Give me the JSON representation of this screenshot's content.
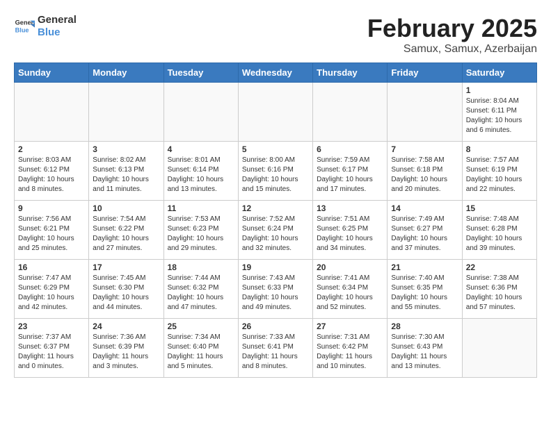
{
  "logo": {
    "line1": "General",
    "line2": "Blue"
  },
  "title": "February 2025",
  "subtitle": "Samux, Samux, Azerbaijan",
  "weekdays": [
    "Sunday",
    "Monday",
    "Tuesday",
    "Wednesday",
    "Thursday",
    "Friday",
    "Saturday"
  ],
  "weeks": [
    [
      {
        "day": "",
        "info": ""
      },
      {
        "day": "",
        "info": ""
      },
      {
        "day": "",
        "info": ""
      },
      {
        "day": "",
        "info": ""
      },
      {
        "day": "",
        "info": ""
      },
      {
        "day": "",
        "info": ""
      },
      {
        "day": "1",
        "info": "Sunrise: 8:04 AM\nSunset: 6:11 PM\nDaylight: 10 hours\nand 6 minutes."
      }
    ],
    [
      {
        "day": "2",
        "info": "Sunrise: 8:03 AM\nSunset: 6:12 PM\nDaylight: 10 hours\nand 8 minutes."
      },
      {
        "day": "3",
        "info": "Sunrise: 8:02 AM\nSunset: 6:13 PM\nDaylight: 10 hours\nand 11 minutes."
      },
      {
        "day": "4",
        "info": "Sunrise: 8:01 AM\nSunset: 6:14 PM\nDaylight: 10 hours\nand 13 minutes."
      },
      {
        "day": "5",
        "info": "Sunrise: 8:00 AM\nSunset: 6:16 PM\nDaylight: 10 hours\nand 15 minutes."
      },
      {
        "day": "6",
        "info": "Sunrise: 7:59 AM\nSunset: 6:17 PM\nDaylight: 10 hours\nand 17 minutes."
      },
      {
        "day": "7",
        "info": "Sunrise: 7:58 AM\nSunset: 6:18 PM\nDaylight: 10 hours\nand 20 minutes."
      },
      {
        "day": "8",
        "info": "Sunrise: 7:57 AM\nSunset: 6:19 PM\nDaylight: 10 hours\nand 22 minutes."
      }
    ],
    [
      {
        "day": "9",
        "info": "Sunrise: 7:56 AM\nSunset: 6:21 PM\nDaylight: 10 hours\nand 25 minutes."
      },
      {
        "day": "10",
        "info": "Sunrise: 7:54 AM\nSunset: 6:22 PM\nDaylight: 10 hours\nand 27 minutes."
      },
      {
        "day": "11",
        "info": "Sunrise: 7:53 AM\nSunset: 6:23 PM\nDaylight: 10 hours\nand 29 minutes."
      },
      {
        "day": "12",
        "info": "Sunrise: 7:52 AM\nSunset: 6:24 PM\nDaylight: 10 hours\nand 32 minutes."
      },
      {
        "day": "13",
        "info": "Sunrise: 7:51 AM\nSunset: 6:25 PM\nDaylight: 10 hours\nand 34 minutes."
      },
      {
        "day": "14",
        "info": "Sunrise: 7:49 AM\nSunset: 6:27 PM\nDaylight: 10 hours\nand 37 minutes."
      },
      {
        "day": "15",
        "info": "Sunrise: 7:48 AM\nSunset: 6:28 PM\nDaylight: 10 hours\nand 39 minutes."
      }
    ],
    [
      {
        "day": "16",
        "info": "Sunrise: 7:47 AM\nSunset: 6:29 PM\nDaylight: 10 hours\nand 42 minutes."
      },
      {
        "day": "17",
        "info": "Sunrise: 7:45 AM\nSunset: 6:30 PM\nDaylight: 10 hours\nand 44 minutes."
      },
      {
        "day": "18",
        "info": "Sunrise: 7:44 AM\nSunset: 6:32 PM\nDaylight: 10 hours\nand 47 minutes."
      },
      {
        "day": "19",
        "info": "Sunrise: 7:43 AM\nSunset: 6:33 PM\nDaylight: 10 hours\nand 49 minutes."
      },
      {
        "day": "20",
        "info": "Sunrise: 7:41 AM\nSunset: 6:34 PM\nDaylight: 10 hours\nand 52 minutes."
      },
      {
        "day": "21",
        "info": "Sunrise: 7:40 AM\nSunset: 6:35 PM\nDaylight: 10 hours\nand 55 minutes."
      },
      {
        "day": "22",
        "info": "Sunrise: 7:38 AM\nSunset: 6:36 PM\nDaylight: 10 hours\nand 57 minutes."
      }
    ],
    [
      {
        "day": "23",
        "info": "Sunrise: 7:37 AM\nSunset: 6:37 PM\nDaylight: 11 hours\nand 0 minutes."
      },
      {
        "day": "24",
        "info": "Sunrise: 7:36 AM\nSunset: 6:39 PM\nDaylight: 11 hours\nand 3 minutes."
      },
      {
        "day": "25",
        "info": "Sunrise: 7:34 AM\nSunset: 6:40 PM\nDaylight: 11 hours\nand 5 minutes."
      },
      {
        "day": "26",
        "info": "Sunrise: 7:33 AM\nSunset: 6:41 PM\nDaylight: 11 hours\nand 8 minutes."
      },
      {
        "day": "27",
        "info": "Sunrise: 7:31 AM\nSunset: 6:42 PM\nDaylight: 11 hours\nand 10 minutes."
      },
      {
        "day": "28",
        "info": "Sunrise: 7:30 AM\nSunset: 6:43 PM\nDaylight: 11 hours\nand 13 minutes."
      },
      {
        "day": "",
        "info": ""
      }
    ]
  ]
}
